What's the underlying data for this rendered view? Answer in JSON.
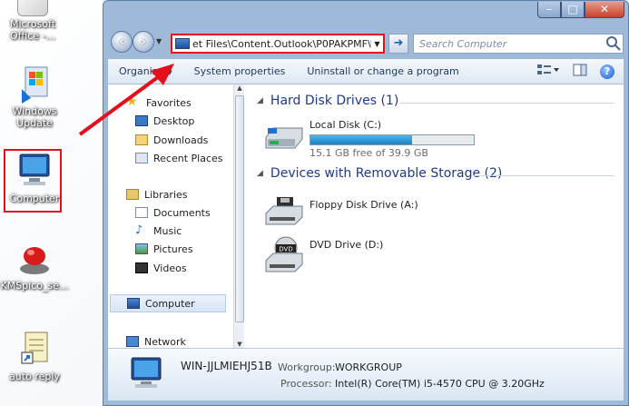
{
  "desktop": {
    "icons": [
      {
        "label_lines": [
          "Microsoft",
          "Office -..."
        ]
      },
      {
        "label_lines": [
          "Windows",
          "Update"
        ]
      },
      {
        "label_lines": [
          "Computer"
        ]
      },
      {
        "label_lines": [
          "KMSpico_se..."
        ]
      },
      {
        "label_lines": [
          "auto reply"
        ]
      }
    ]
  },
  "window": {
    "controls": {
      "minimize": "–",
      "maximize": "□",
      "close": "✕"
    },
    "address_path": "et Files\\Content.Outlook\\P0PAKPMF\\",
    "search_placeholder": "Search Computer",
    "toolbar": {
      "organize": "Organize",
      "system_properties": "System properties",
      "uninstall": "Uninstall or change a program"
    },
    "nav": {
      "favorites": "Favorites",
      "desktop": "Desktop",
      "downloads": "Downloads",
      "recent_places": "Recent Places",
      "libraries": "Libraries",
      "documents": "Documents",
      "music": "Music",
      "pictures": "Pictures",
      "videos": "Videos",
      "computer": "Computer",
      "network": "Network"
    },
    "content": {
      "hdd_group": "Hard Disk Drives (1)",
      "local_disk": "Local Disk (C:)",
      "local_disk_free": "15.1 GB free of 39.9 GB",
      "local_disk_used_fraction": 0.62,
      "removable_group": "Devices with Removable Storage (2)",
      "floppy": "Floppy Disk Drive (A:)",
      "dvd": "DVD Drive (D:)",
      "dvd_label": "DVD"
    },
    "details": {
      "pc_name": "WIN-JJLMIEHJ51B",
      "workgroup_label": "Workgroup:",
      "workgroup": "WORKGROUP",
      "processor_label": "Processor:",
      "processor": "Intel(R) Core(TM) i5-4570 CPU @ 3.20GHz"
    }
  },
  "colors": {
    "highlight": "#e30f1b",
    "group_text": "#1e3a8a",
    "bar_fill": "#1d7fc1"
  }
}
